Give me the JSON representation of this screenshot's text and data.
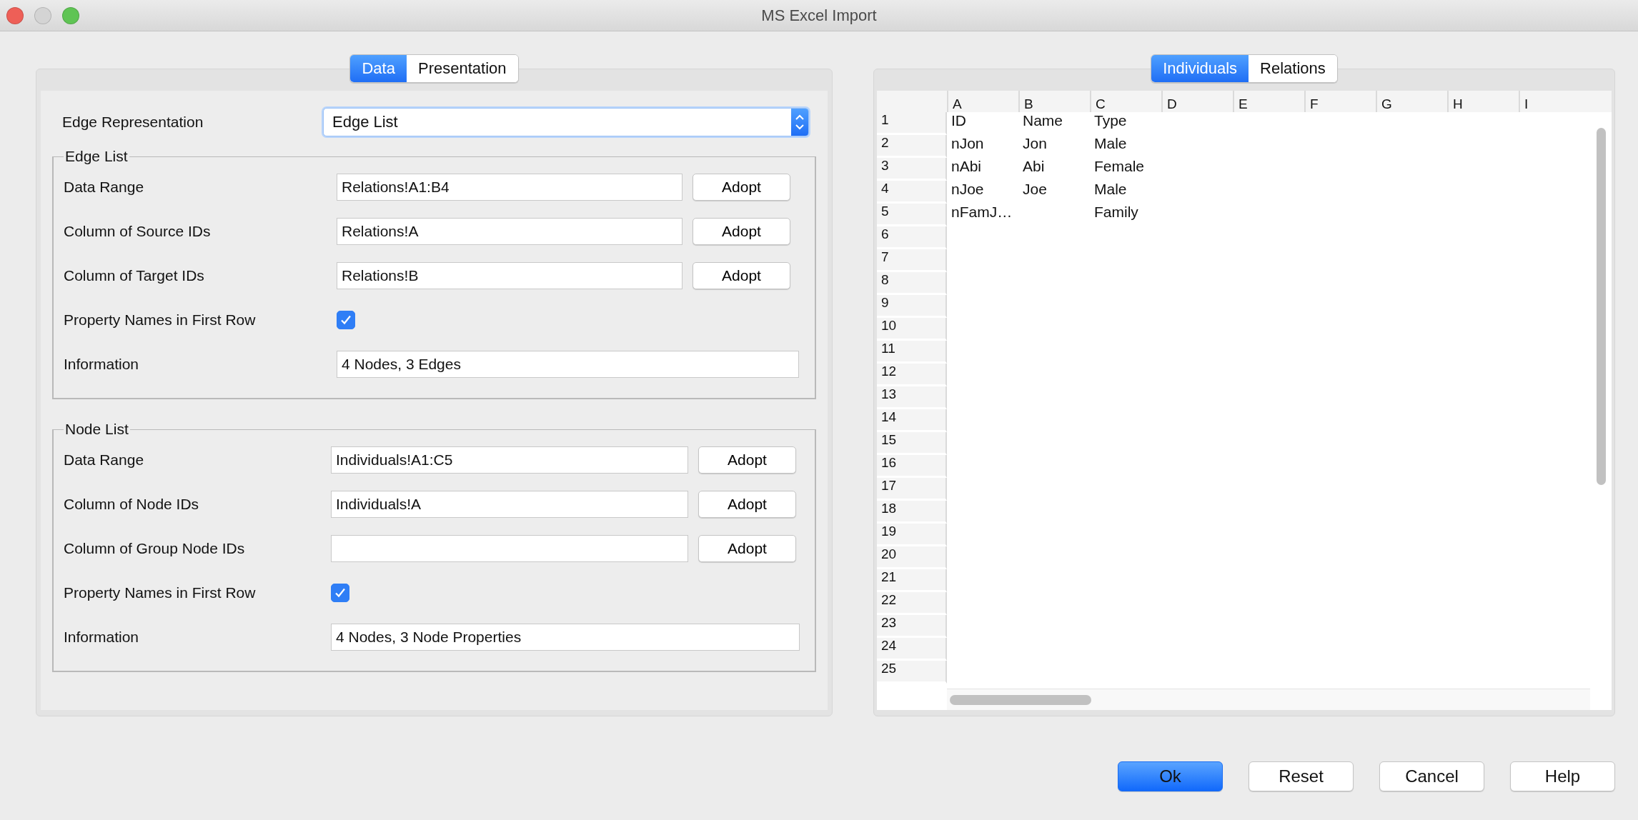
{
  "window": {
    "title": "MS Excel Import"
  },
  "left_tabs": [
    {
      "label": "Data",
      "selected": true
    },
    {
      "label": "Presentation",
      "selected": false
    }
  ],
  "edge_representation": {
    "label": "Edge Representation",
    "value": "Edge List"
  },
  "edge_list": {
    "title": "Edge List",
    "rows": [
      {
        "kind": "range",
        "label": "Data Range",
        "value": "Relations!A1:B4",
        "button": "Adopt"
      },
      {
        "kind": "range",
        "label": "Column of Source IDs",
        "value": "Relations!A",
        "button": "Adopt"
      },
      {
        "kind": "range",
        "label": "Column of Target IDs",
        "value": "Relations!B",
        "button": "Adopt"
      },
      {
        "kind": "checkbox",
        "label": "Property Names in First Row",
        "checked": true
      },
      {
        "kind": "info",
        "label": "Information",
        "value": "4 Nodes, 3 Edges"
      }
    ]
  },
  "node_list": {
    "title": "Node List",
    "rows": [
      {
        "kind": "range",
        "label": "Data Range",
        "value": "Individuals!A1:C5",
        "button": "Adopt"
      },
      {
        "kind": "range",
        "label": "Column of Node IDs",
        "value": "Individuals!A",
        "button": "Adopt"
      },
      {
        "kind": "range",
        "label": "Column of Group Node IDs",
        "button": "Adopt"
      },
      {
        "kind": "checkbox",
        "label": "Property Names in First Row",
        "checked": true
      },
      {
        "kind": "info",
        "label": "Information",
        "value": "4 Nodes, 3 Node Properties"
      }
    ]
  },
  "right_tabs": [
    {
      "label": "Individuals",
      "selected": true
    },
    {
      "label": "Relations",
      "selected": false
    }
  ],
  "sheet": {
    "columns": [
      "A",
      "B",
      "C",
      "D",
      "E",
      "F",
      "G",
      "H",
      "I"
    ],
    "rows": [
      {
        "number": "1",
        "cells": [
          "ID",
          "Name",
          "Type"
        ]
      },
      {
        "number": "2",
        "cells": [
          "nJon",
          "Jon",
          "Male"
        ]
      },
      {
        "number": "3",
        "cells": [
          "nAbi",
          "Abi",
          "Female"
        ]
      },
      {
        "number": "4",
        "cells": [
          "nJoe",
          "Joe",
          "Male"
        ]
      },
      {
        "number": "5",
        "cells": [
          "nFamJ…",
          "",
          "Family"
        ]
      },
      {
        "number": "6"
      },
      {
        "number": "7"
      },
      {
        "number": "8"
      },
      {
        "number": "9"
      },
      {
        "number": "10"
      },
      {
        "number": "11"
      },
      {
        "number": "12"
      },
      {
        "number": "13"
      },
      {
        "number": "14"
      },
      {
        "number": "15"
      },
      {
        "number": "16"
      },
      {
        "number": "17"
      },
      {
        "number": "18"
      },
      {
        "number": "19"
      },
      {
        "number": "20"
      },
      {
        "number": "21"
      },
      {
        "number": "22"
      },
      {
        "number": "23"
      },
      {
        "number": "24"
      },
      {
        "number": "25"
      }
    ]
  },
  "buttons": [
    {
      "label": "Ok",
      "default": true
    },
    {
      "label": "Reset",
      "default": false
    },
    {
      "label": "Cancel",
      "default": false
    },
    {
      "label": "Help",
      "default": false
    }
  ]
}
